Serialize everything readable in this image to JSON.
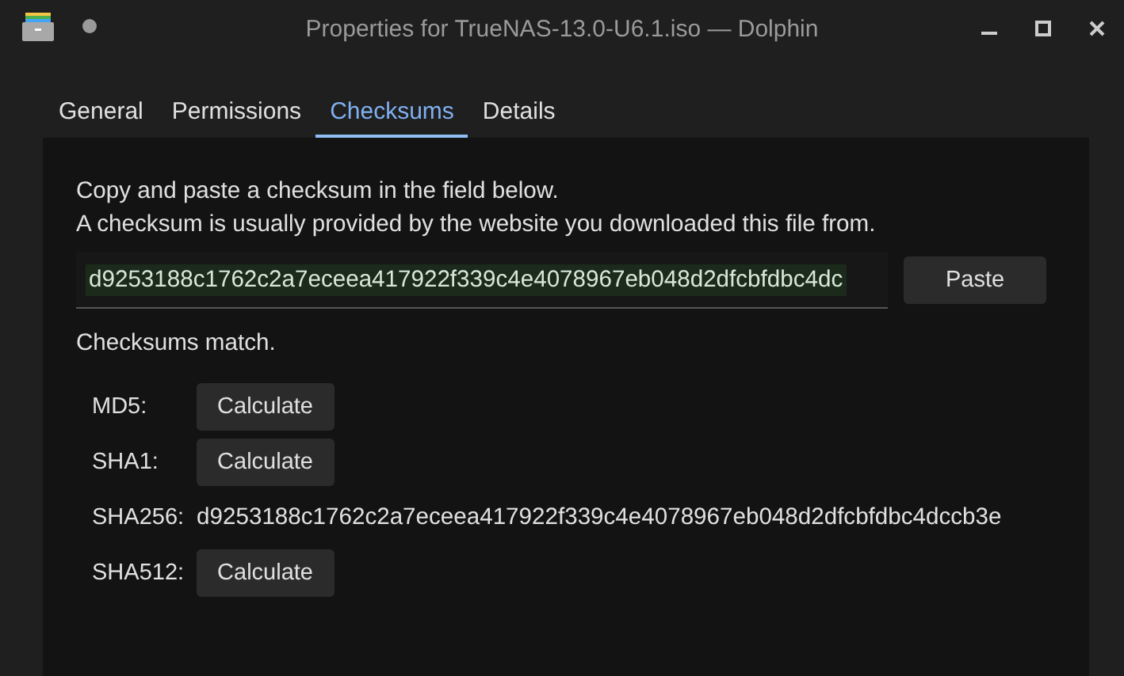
{
  "window": {
    "title": "Properties for TrueNAS-13.0-U6.1.iso — Dolphin"
  },
  "tabs": [
    {
      "label": "General",
      "selected": false
    },
    {
      "label": "Permissions",
      "selected": false
    },
    {
      "label": "Checksums",
      "selected": true
    },
    {
      "label": "Details",
      "selected": false
    }
  ],
  "intro": [
    "Copy and paste a checksum in the field below.",
    "A checksum is usually provided by the website you downloaded this file from."
  ],
  "checksum_field": {
    "value": "d9253188c1762c2a7eceea417922f339c4e4078967eb048d2dfcbfdbc4dc",
    "matched": true
  },
  "paste_button": "Paste",
  "status": "Checksums match.",
  "algorithms": [
    {
      "label": "MD5:",
      "kind": "button",
      "text": "Calculate"
    },
    {
      "label": "SHA1:",
      "kind": "button",
      "text": "Calculate"
    },
    {
      "label": "SHA256:",
      "kind": "value",
      "text": "d9253188c1762c2a7eceea417922f339c4e4078967eb048d2dfcbfdbc4dccb3e"
    },
    {
      "label": "SHA512:",
      "kind": "button",
      "text": "Calculate"
    }
  ]
}
